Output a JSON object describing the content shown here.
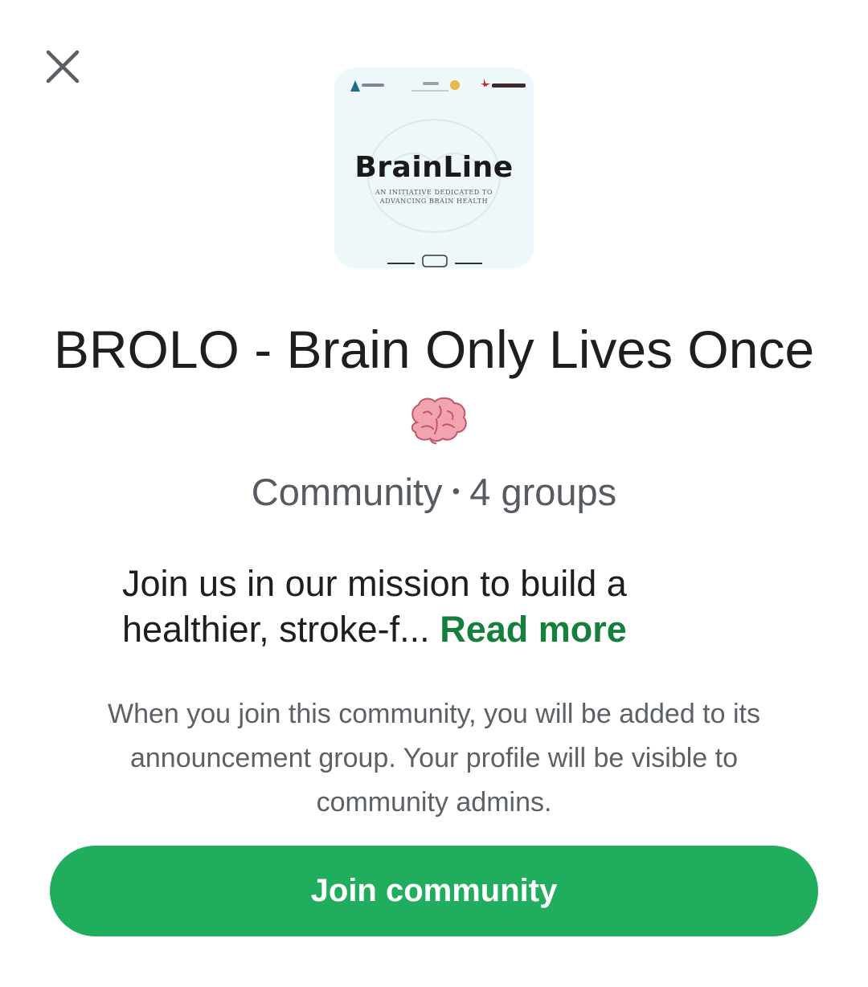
{
  "header": {
    "close_icon": "close-icon"
  },
  "logo": {
    "brand_name": "BrainLine",
    "tagline": "AN INITIATIVE DEDICATED TO ADVANCING BRAIN HEALTH",
    "background": "#eef7fa"
  },
  "community": {
    "title": "BROLO - Brain Only Lives Once",
    "title_emoji": "brain-emoji",
    "type_label": "Community",
    "separator": "•",
    "groups_label": "4 groups",
    "description": "Join us in our mission to build a healthier, stroke-f...",
    "read_more_label": "Read more",
    "notice": "When you join this community, you will be added to its announcement group. Your profile will be visible to community admins."
  },
  "actions": {
    "join_label": "Join community"
  },
  "colors": {
    "accent": "#21ad5e",
    "link": "#15803d",
    "text": "#1c1e21",
    "muted": "#5c6166"
  }
}
